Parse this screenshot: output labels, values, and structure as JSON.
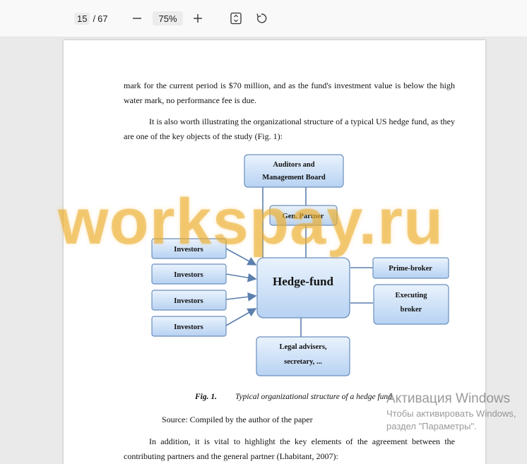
{
  "toolbar": {
    "current_page": "15",
    "page_separator": "/",
    "total_pages": "67",
    "zoom": "75%",
    "icons": [
      "minus-icon",
      "plus-icon",
      "fit-page-icon",
      "rotate-icon"
    ]
  },
  "document": {
    "para1": "mark for the current period is $70 million, and as the fund's investment value is below the high water mark, no performance fee is due.",
    "para2": "It is also worth illustrating the organizational structure of a typical US hedge fund, as they are one of the key objects of the study (Fig. 1):",
    "diagram": {
      "auditors_line1": "Auditors and",
      "auditors_line2": "Management Board",
      "gen_partner": "Gen. Partner",
      "investors": [
        "Investors",
        "Investors",
        "Investors",
        "Investors"
      ],
      "hedge_fund": "Hedge-fund",
      "prime_broker": "Prime-broker",
      "executing_line1": "Executing",
      "executing_line2": "broker",
      "legal_line1": "Legal advisers,",
      "legal_line2": "secretary, ..."
    },
    "caption_num": "Fig. 1.",
    "caption_text": "Typical organizational structure of a hedge fund",
    "source": "Source: Compiled by the author of the paper",
    "para3": "In addition, it is vital to highlight the key elements of the agreement between the contributing partners and the general partner (Lhabitant, 2007):"
  },
  "overlay": {
    "watermark": "workspay.ru",
    "activation_title": "Активация Windows",
    "activation_line1": "Чтобы активировать Windows,",
    "activation_line2": "раздел \"Параметры\"."
  },
  "colors": {
    "box_fill_top": "#eaf3fd",
    "box_fill_bottom": "#b7d2f2",
    "box_stroke": "#6b8fbf",
    "connector": "#5b7fae",
    "watermark": "#e8aa28"
  }
}
